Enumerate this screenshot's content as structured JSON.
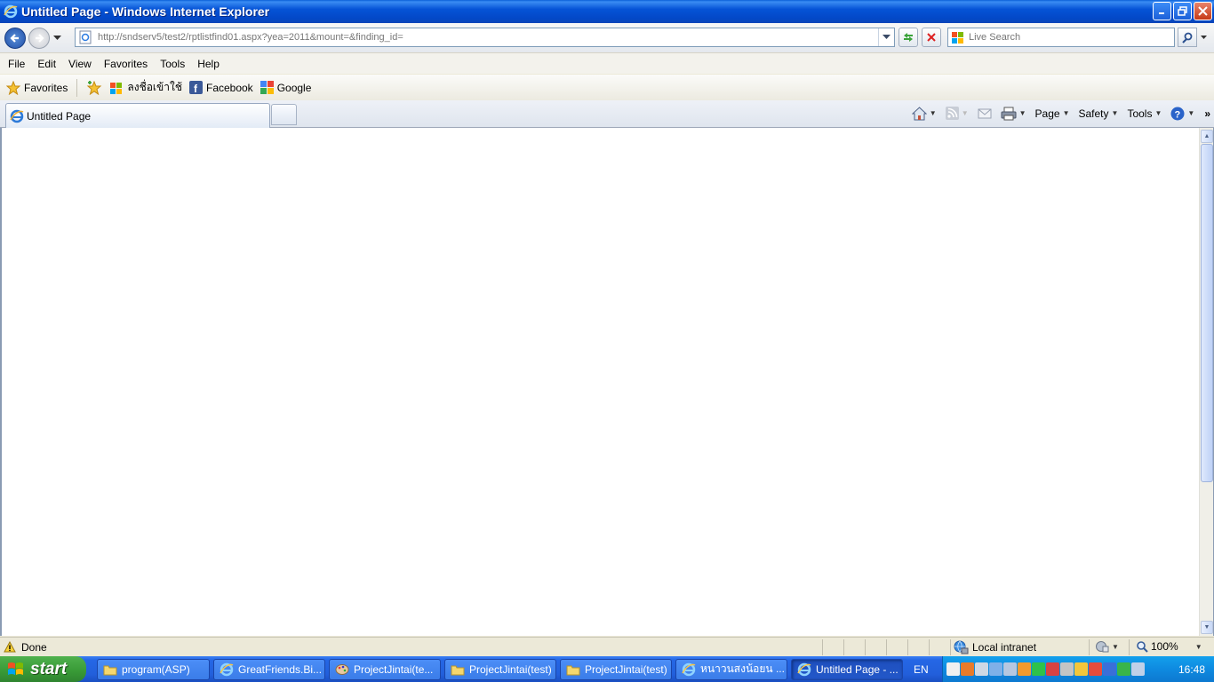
{
  "window": {
    "title": "Untitled Page - Windows Internet Explorer"
  },
  "address": {
    "url": "http://sndserv5/test2/rptlistfind01.aspx?yea=2011&mount=&finding_id="
  },
  "search": {
    "placeholder": "Live Search"
  },
  "menu": {
    "items": [
      "File",
      "Edit",
      "View",
      "Favorites",
      "Tools",
      "Help"
    ]
  },
  "favorites": {
    "favorites_label": "Favorites",
    "links": [
      "ลงชื่อเข้าใช้",
      "Facebook",
      "Google"
    ]
  },
  "tabs": {
    "active_label": "Untitled Page"
  },
  "commandbar": {
    "page_label": "Page",
    "safety_label": "Safety",
    "tools_label": "Tools"
  },
  "status": {
    "text": "Done",
    "zone": "Local intranet",
    "zoom": "100%"
  },
  "taskbar": {
    "start_label": "start",
    "tasks": [
      {
        "label": "program(ASP)",
        "icon": "folder-icon"
      },
      {
        "label": "GreatFriends.Bi...",
        "icon": "ie-icon"
      },
      {
        "label": "ProjectJintai(te...",
        "icon": "paint-icon"
      },
      {
        "label": "ProjectJintai(test)",
        "icon": "folder-icon"
      },
      {
        "label": "ProjectJintai(test)",
        "icon": "folder-icon"
      },
      {
        "label": "หนาวนสงน้อยน ...",
        "icon": "ie-icon"
      },
      {
        "label": "Untitled Page - ...",
        "icon": "ie-icon"
      }
    ],
    "language": "EN",
    "clock": "16:48"
  },
  "colors": {
    "titlebar": "#0553d6",
    "taskbar": "#225fdb",
    "start_green": "#389936",
    "tray": "#0e8ae0"
  }
}
